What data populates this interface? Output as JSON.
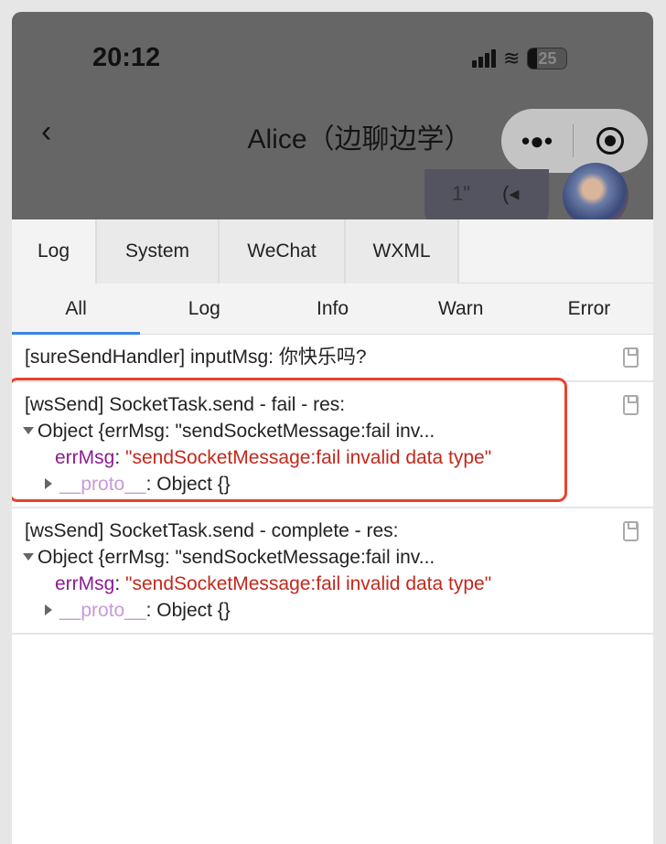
{
  "status_bar": {
    "time": "20:12",
    "battery": "25"
  },
  "nav": {
    "title": "Alice（边聊边学）",
    "more_label": "•●•"
  },
  "chat": {
    "voice_duration": "1\"",
    "voice_icon": "(◂"
  },
  "tabs": [
    {
      "label": "Log",
      "active": true
    },
    {
      "label": "System"
    },
    {
      "label": "WeChat"
    },
    {
      "label": "WXML"
    }
  ],
  "filters": [
    {
      "label": "All",
      "active": true
    },
    {
      "label": "Log"
    },
    {
      "label": "Info"
    },
    {
      "label": "Warn"
    },
    {
      "label": "Error"
    }
  ],
  "logs": [
    {
      "text": "[sureSendHandler] inputMsg: 你快乐吗?"
    },
    {
      "text": "[wsSend] SocketTask.send - fail - res:",
      "summary": "Object {errMsg: \"sendSocketMessage:fail inv...",
      "key": "errMsg",
      "colon": ":",
      "value": "\"sendSocketMessage:fail invalid data type\"",
      "proto": "__proto__",
      "proto_value": ": Object {}",
      "highlighted": true
    },
    {
      "text": "[wsSend] SocketTask.send - complete - res:",
      "summary": "Object {errMsg: \"sendSocketMessage:fail inv...",
      "key": "errMsg",
      "colon": ":",
      "value": "\"sendSocketMessage:fail invalid data type\"",
      "proto": "__proto__",
      "proto_value": ": Object {}"
    }
  ],
  "colors": {
    "highlight": "#e7432d",
    "key": "#8b1d91",
    "string": "#c4281c",
    "active_tab": "#3b82e6"
  }
}
